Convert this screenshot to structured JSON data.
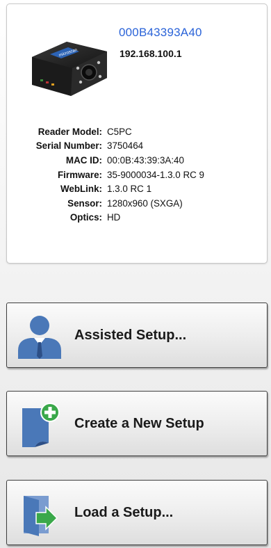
{
  "device": {
    "name": "000B43393A40",
    "ip": "192.168.100.1",
    "image_icon": "barcode-reader-camera",
    "details": [
      {
        "label": "Reader Model:",
        "value": "C5PC"
      },
      {
        "label": "Serial Number:",
        "value": "3750464"
      },
      {
        "label": "MAC ID:",
        "value": "00:0B:43:39:3A:40"
      },
      {
        "label": "Firmware:",
        "value": "35-9000034-1.3.0 RC 9"
      },
      {
        "label": "WebLink:",
        "value": "1.3.0 RC 1"
      },
      {
        "label": "Sensor:",
        "value": "1280x960 (SXGA)"
      },
      {
        "label": "Optics:",
        "value": "HD"
      }
    ]
  },
  "actions": {
    "assisted_setup": {
      "label": "Assisted Setup...",
      "icon": "user-icon"
    },
    "create_new_setup": {
      "label": "Create a New Setup",
      "icon": "new-document-icon"
    },
    "load_setup": {
      "label": "Load a Setup...",
      "icon": "open-folder-icon"
    }
  },
  "colors": {
    "accent_link": "#2a63d8",
    "icon_blue": "#4a78b8",
    "icon_green": "#3aa84a"
  }
}
